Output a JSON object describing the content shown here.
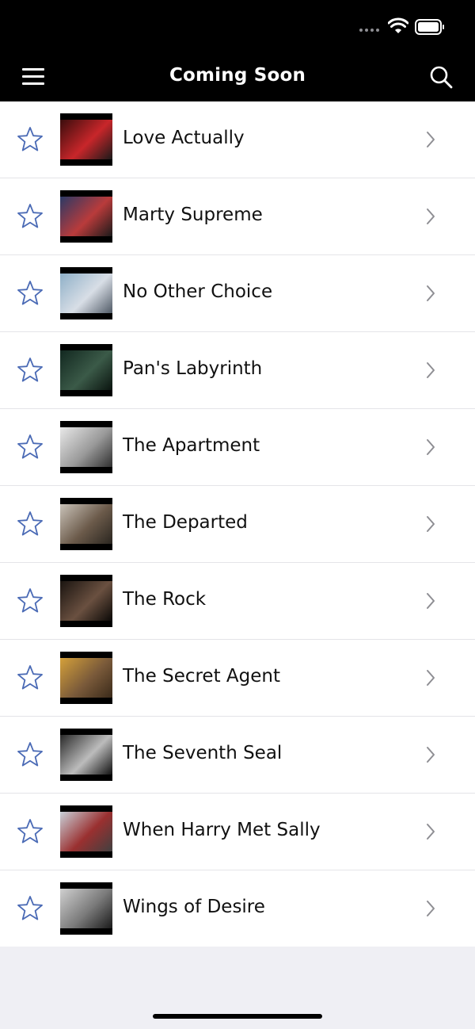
{
  "header": {
    "title": "Coming Soon",
    "menu_icon": "hamburger-menu-icon",
    "search_icon": "search-icon"
  },
  "colors": {
    "bar_background": "#000000",
    "star_outline": "#4a6ab5",
    "chevron": "#8e8e93",
    "page_background": "#efeff4"
  },
  "movies": [
    {
      "title": "Love Actually",
      "thumb_colors": [
        "#3a0d0d",
        "#c8262a",
        "#1a1a1a"
      ]
    },
    {
      "title": "Marty Supreme",
      "thumb_colors": [
        "#2b3a66",
        "#b93b3b",
        "#1a1a1a"
      ]
    },
    {
      "title": "No Other Choice",
      "thumb_colors": [
        "#8fb0c8",
        "#d8dee6",
        "#505a66"
      ]
    },
    {
      "title": "Pan's Labyrinth",
      "thumb_colors": [
        "#122820",
        "#3b5a48",
        "#0a140f"
      ]
    },
    {
      "title": "The Apartment",
      "thumb_colors": [
        "#e8e8e8",
        "#9a9a9a",
        "#303030"
      ]
    },
    {
      "title": "The Departed",
      "thumb_colors": [
        "#c9c2b8",
        "#6b5a4a",
        "#2a2620"
      ]
    },
    {
      "title": "The Rock",
      "thumb_colors": [
        "#1a1410",
        "#6a5040",
        "#0a0806"
      ]
    },
    {
      "title": "The Secret Agent",
      "thumb_colors": [
        "#d4a03a",
        "#7a5a3a",
        "#3a2a1a"
      ]
    },
    {
      "title": "The Seventh Seal",
      "thumb_colors": [
        "#2a2a2a",
        "#bcbcbc",
        "#101010"
      ]
    },
    {
      "title": "When Harry Met Sally",
      "thumb_colors": [
        "#c8d0d8",
        "#9a3030",
        "#404040"
      ]
    },
    {
      "title": "Wings of Desire",
      "thumb_colors": [
        "#d0d0d0",
        "#7a7a7a",
        "#1a1a1a"
      ]
    }
  ]
}
